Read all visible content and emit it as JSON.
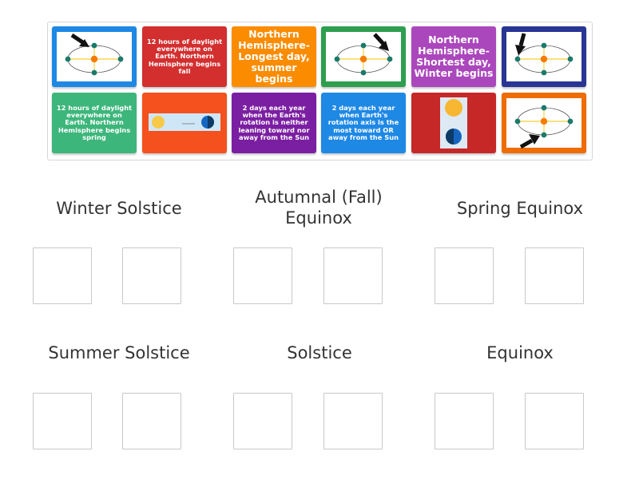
{
  "cards": [
    {
      "id": "c1",
      "type": "orbit",
      "arrow": "top-left",
      "text": ""
    },
    {
      "id": "c2",
      "type": "text",
      "text": "12 hours of daylight everywhere on Earth. Northern Hemisphere begins fall"
    },
    {
      "id": "c3",
      "type": "text",
      "text": "Northern Hemisphere-Longest day, summer begins"
    },
    {
      "id": "c4",
      "type": "orbit",
      "arrow": "right",
      "text": ""
    },
    {
      "id": "c5",
      "type": "text",
      "text": "Northern Hemisphere-Shortest day, Winter begins"
    },
    {
      "id": "c6",
      "type": "orbit",
      "arrow": "left",
      "text": ""
    },
    {
      "id": "c7",
      "type": "text",
      "text": "12 hours of daylight everywhere on Earth. Northern Hemisphere begins spring"
    },
    {
      "id": "c8",
      "type": "image",
      "text": ""
    },
    {
      "id": "c9",
      "type": "text",
      "text": "2 days each year when the Earth's rotation is neither leaning toward nor away from the Sun"
    },
    {
      "id": "c10",
      "type": "text",
      "text": "2 days each year when Earth's rotation axis is the most toward OR away from the Sun"
    },
    {
      "id": "c11",
      "type": "image",
      "text": ""
    },
    {
      "id": "c12",
      "type": "orbit",
      "arrow": "bottom-left",
      "text": ""
    }
  ],
  "categories": [
    {
      "label": "Winter Solstice"
    },
    {
      "label": "Autumnal (Fall) Equinox"
    },
    {
      "label": "Spring Equinox"
    },
    {
      "label": "Summer Solstice"
    },
    {
      "label": "Solstice"
    },
    {
      "label": "Equinox"
    }
  ],
  "colors": {
    "blue": "#1e88e5",
    "red": "#d32f2f",
    "orange": "#fb8c00",
    "green": "#2e9e4f",
    "purple": "#ab47bc",
    "navy": "#283593",
    "teal": "#3db67b",
    "redorange": "#f4511e",
    "violet": "#7b1fa2",
    "sky": "#1e88e5",
    "crimson": "#c62828",
    "orange2": "#ef6c00"
  },
  "icons": {
    "orbit": "earth-orbit-diagram",
    "arrow": "pointer-arrow-icon",
    "sun": "sun-icon",
    "earth": "earth-icon"
  }
}
